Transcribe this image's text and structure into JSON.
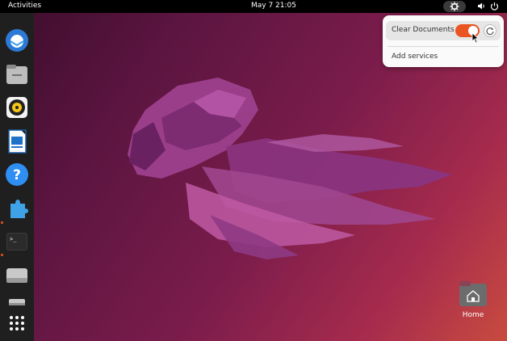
{
  "topbar": {
    "activities_label": "Activities",
    "clock": "May 7  21:05",
    "tray_icons": [
      "settings-icon",
      "volume-icon",
      "power-icon"
    ]
  },
  "dock": {
    "apps": [
      "thunderbird",
      "files",
      "rhythmbox",
      "libreoffice-writer",
      "help",
      "app-center",
      "terminal",
      "drive",
      "drive-2",
      "show-apps"
    ]
  },
  "panel": {
    "toggle_label": "Clear Documents",
    "toggle_state": "on",
    "add_services_label": "Add services"
  },
  "desktop": {
    "home_label": "Home"
  },
  "colors": {
    "accent": "#e95420",
    "dock_bg": "#1f1f1f",
    "topbar_bg": "#000000"
  }
}
